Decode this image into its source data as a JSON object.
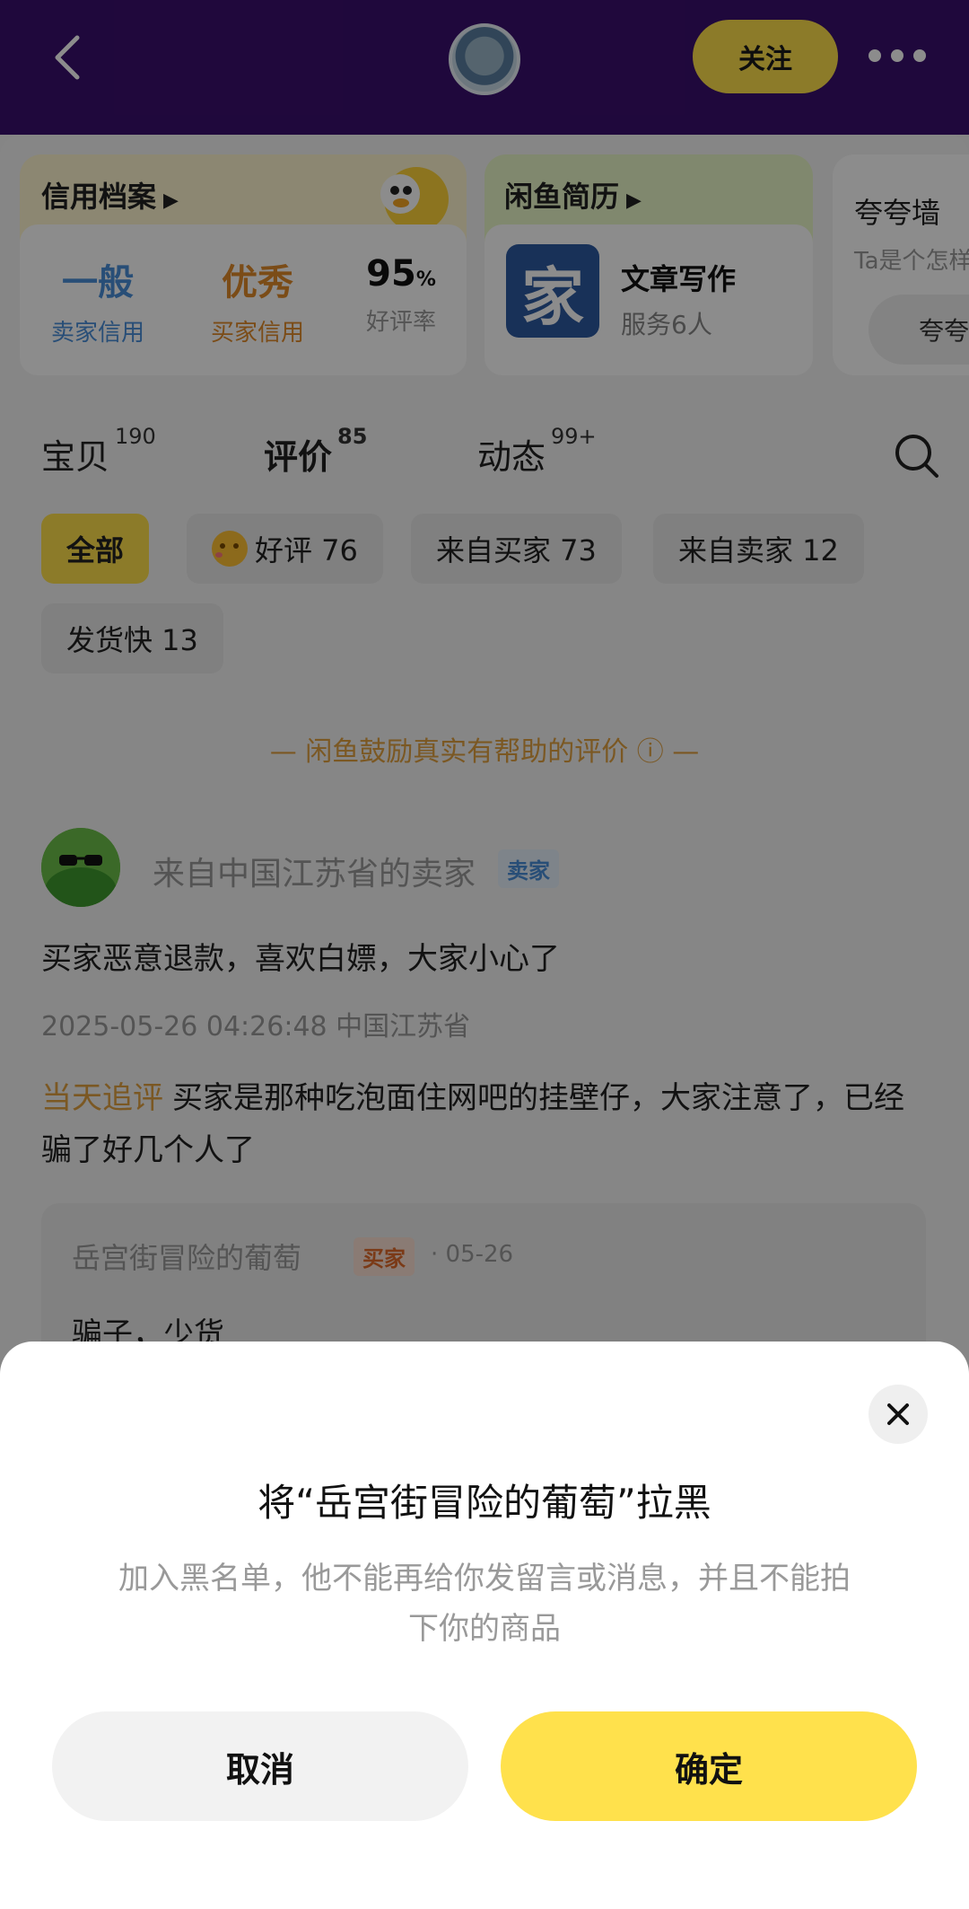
{
  "header": {
    "follow_label": "关注"
  },
  "credit": {
    "title": "信用档案",
    "seller_value": "一般",
    "seller_label": "卖家信用",
    "buyer_value": "优秀",
    "buyer_label": "买家信用",
    "rate_value": "95",
    "rate_unit": "%",
    "rate_label": "好评率",
    "colors": {
      "seller": "#4a8fd9",
      "buyer": "#e08a2a"
    }
  },
  "resume": {
    "title": "闲鱼简历",
    "service_name": "文章写作",
    "service_count": "服务6人",
    "thumb_char": "家"
  },
  "praise": {
    "title": "夸夸墙",
    "subtitle": "Ta是个怎样",
    "button": "夸夸"
  },
  "tabs": [
    {
      "label": "宝贝",
      "count": "190"
    },
    {
      "label": "评价",
      "count": "85"
    },
    {
      "label": "动态",
      "count": "99+"
    }
  ],
  "chips": [
    "全部",
    "好评 76",
    "来自买家 73",
    "来自卖家 12",
    "发货快 13"
  ],
  "encourage_text": "— 闲鱼鼓励真实有帮助的评价 ⓘ —",
  "review": {
    "name": "来自中国江苏省的卖家",
    "badge": "卖家",
    "text": "买家恶意退款，喜欢白嫖，大家小心了",
    "meta": "2025-05-26 04:26:48  中国江苏省",
    "followup_tag": "当天追评",
    "followup_text": "买家是那种吃泡面住网吧的挂壁仔，大家注意了，已经骗了好几个人了",
    "reply": {
      "name": "岳宫街冒险的葡萄",
      "badge": "买家",
      "date": "· 05-26",
      "text": "骗子，少货"
    }
  },
  "dialog": {
    "title": "将“岳宫街冒险的葡萄”拉黑",
    "description": "加入黑名单，他不能再给你发留言或消息，并且不能拍下你的商品",
    "cancel_label": "取消",
    "confirm_label": "确定"
  }
}
